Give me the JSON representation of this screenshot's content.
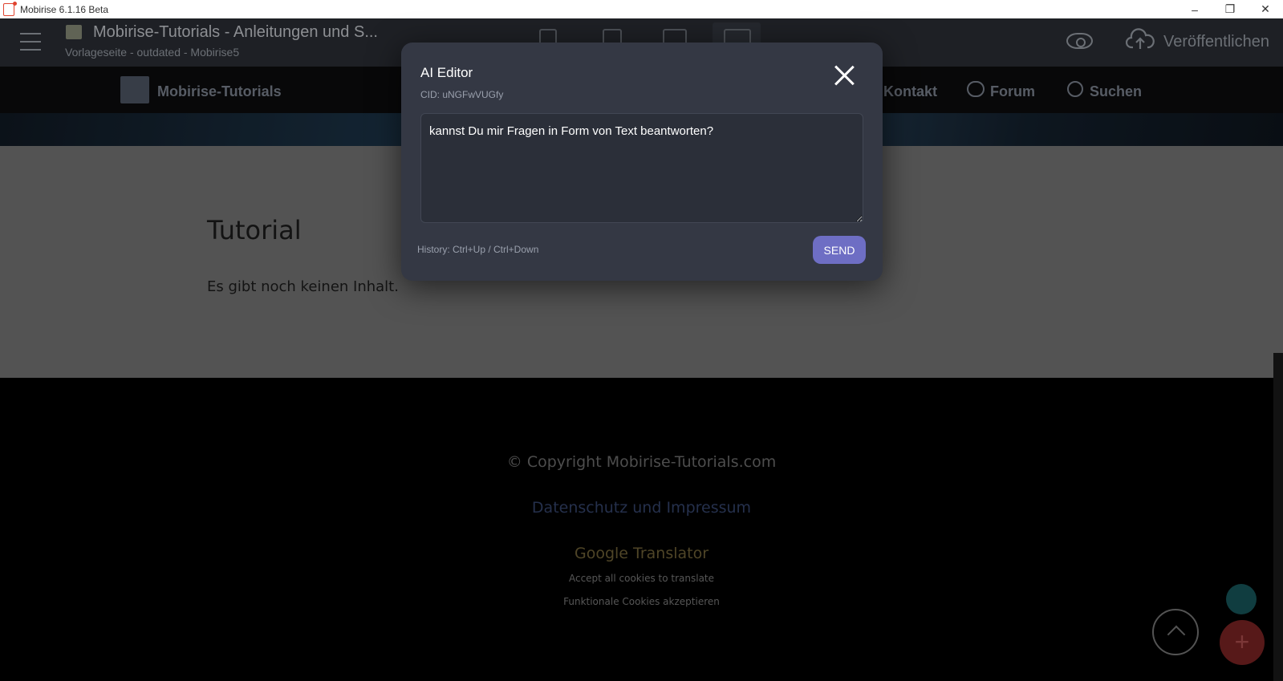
{
  "window": {
    "title": "Mobirise 6.1.16 Beta",
    "minimize": "–",
    "restore": "❐",
    "close": "✕"
  },
  "editor": {
    "project_title": "Mobirise-Tutorials - Anleitungen und S...",
    "page_subtitle": "Vorlageseite - outdated - Mobirise5",
    "publish_label": "Veröffentlichen"
  },
  "site": {
    "brand": "Mobirise-Tutorials",
    "nav": [
      {
        "label": "Kontakt"
      },
      {
        "label": "Forum"
      },
      {
        "label": "Suchen"
      }
    ],
    "heading": "Tutorial",
    "body_text": "Es gibt noch keinen Inhalt.",
    "footer": {
      "copyright": "© Copyright Mobirise-Tutorials.com",
      "privacy_link": "Datenschutz und Impressum",
      "translator_title": "Google Translator",
      "cookies_note": "Accept all cookies to translate",
      "cookies_link": "Funktionale Cookies akzeptieren"
    }
  },
  "modal": {
    "title": "AI Editor",
    "cid": "CID: uNGFwVUGfy",
    "prompt_value": "kannst Du mir Fragen in Form von Text beantworten?",
    "history_hint": "History: Ctrl+Up / Ctrl+Down",
    "send_label": "SEND"
  },
  "fab": {
    "add_symbol": "+"
  },
  "colors": {
    "modal_bg": "#343844",
    "send_button": "#6e6ec4",
    "add_fab": "#7d2424",
    "style_fab": "#18585c"
  }
}
